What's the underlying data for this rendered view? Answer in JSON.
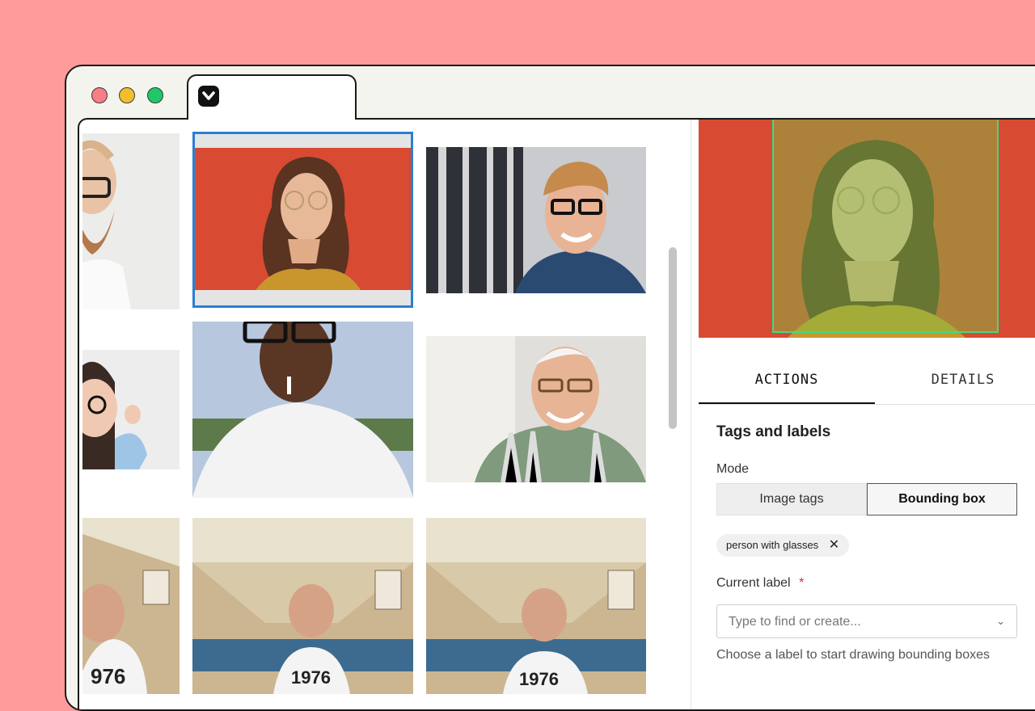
{
  "colors": {
    "background": "#ff9b9b",
    "accent_selected": "#2a7fd4",
    "bbox": "#3ddc84",
    "required": "#d32f2f"
  },
  "window": {
    "traffic_lights": [
      "#f77d87",
      "#f3be2c",
      "#1fc76a"
    ],
    "tab_icon": "chevron-logo-icon"
  },
  "grid": {
    "images": [
      "bearded-man-glasses",
      "woman-glasses-red-background",
      "smiling-man-glasses-office",
      "woman-adjusting-glasses",
      "man-glasses-cigarette",
      "older-man-glasses-smiling",
      "man-webcam-1976-shirt",
      "man-webcam-1976-shirt",
      "man-webcam-1976-shirt"
    ],
    "selected_index": 1
  },
  "panel": {
    "tabs": [
      "ACTIONS",
      "DETAILS"
    ],
    "active_tab": "ACTIONS",
    "section_title": "Tags and labels",
    "mode_label": "Mode",
    "modes": [
      "Image tags",
      "Bounding box"
    ],
    "active_mode": "Bounding box",
    "chip_label": "person with glasses",
    "current_label": "Current label",
    "required_mark": "*",
    "search_placeholder": "Type to find or create...",
    "help_text": "Choose a label to start drawing bounding boxes"
  }
}
